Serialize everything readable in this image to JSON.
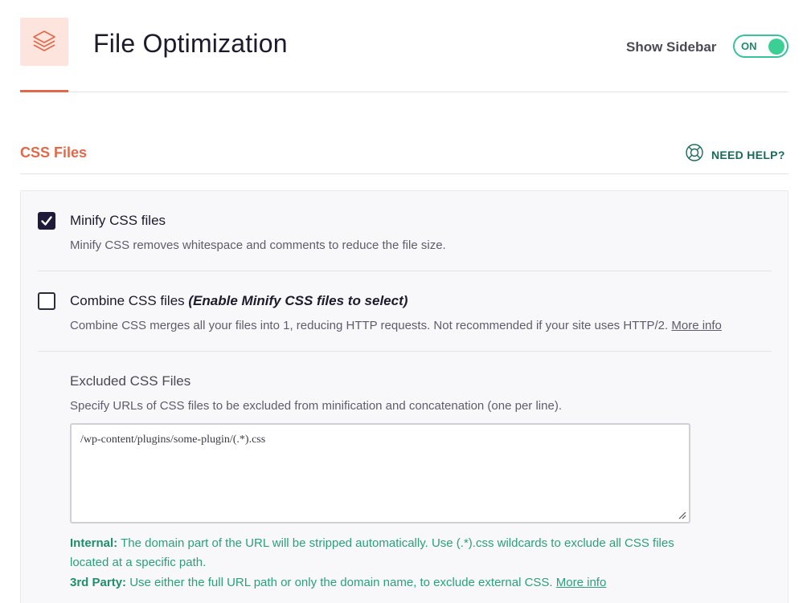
{
  "header": {
    "title": "File Optimization",
    "sidebar_label": "Show Sidebar",
    "toggle_state": "ON"
  },
  "section": {
    "title": "CSS Files",
    "help_label": "NEED HELP?"
  },
  "options": {
    "minify": {
      "checked": true,
      "label": "Minify CSS files",
      "description": "Minify CSS removes whitespace and comments to reduce the file size."
    },
    "combine": {
      "checked": false,
      "label": "Combine CSS files",
      "label_hint": "(Enable Minify CSS files to select)",
      "description": "Combine CSS merges all your files into 1, reducing HTTP requests. Not recommended if your site uses HTTP/2.",
      "more_info": "More info"
    }
  },
  "excluded": {
    "title": "Excluded CSS Files",
    "description": "Specify URLs of CSS files to be excluded from minification and concatenation (one per line).",
    "value": "/wp-content/plugins/some-plugin/(.*).css",
    "notes": {
      "internal_label": "Internal:",
      "internal_text": "The domain part of the URL will be stripped automatically. Use (.*).css wildcards to exclude all CSS files located at a specific path.",
      "third_party_label": "3rd Party:",
      "third_party_text": "Use either the full URL path or only the domain name, to exclude external CSS.",
      "more_info": "More info"
    }
  },
  "colors": {
    "accent": "#e2684a",
    "toggle_on": "#3ccf95",
    "note_green": "#2aa178",
    "checkbox_dark": "#1f1a3a"
  },
  "icons": {
    "logo": "layers-icon",
    "help": "lifebuoy-icon",
    "check": "checkmark-icon",
    "resize": "resize-grip-icon"
  }
}
